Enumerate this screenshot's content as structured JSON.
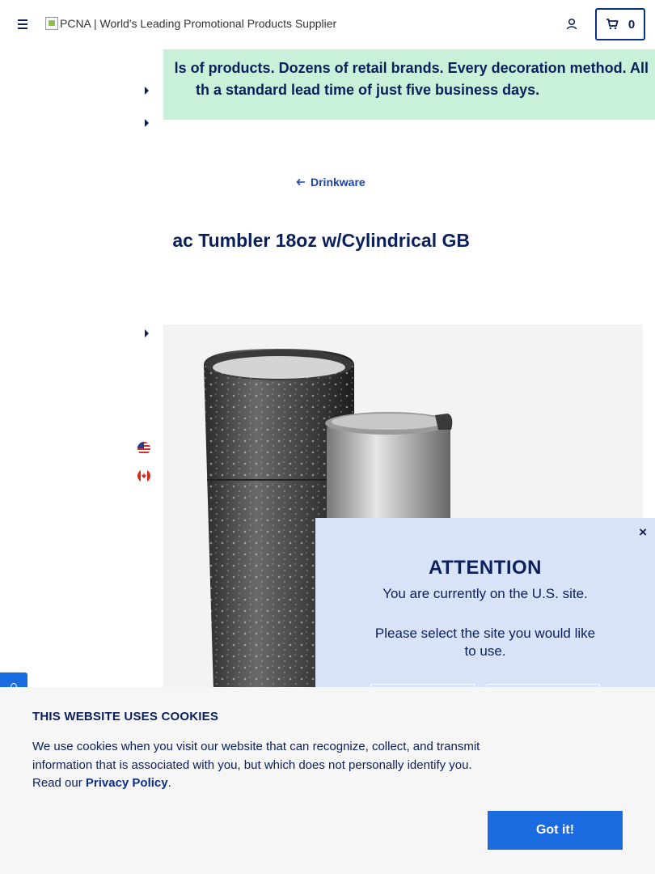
{
  "header": {
    "logo_alt": "PCNA | World's Leading Promotional Products Supplier",
    "menu_icon": "hamburger-menu-icon",
    "account_icon": "user-icon",
    "cart_icon": "cart-icon",
    "cart_count": "0"
  },
  "banner": {
    "line1": "ls of products. Dozens of retail brands. Every decoration method. All",
    "line2": "th a standard lead time of just five business days."
  },
  "breadcrumb": {
    "back_label": "Drinkware",
    "back_icon": "arrow-left-icon"
  },
  "product": {
    "title": "ac Tumbler 18oz w/Cylindrical GB"
  },
  "locale_flags": [
    {
      "icon": "us-flag-icon"
    },
    {
      "icon": "canada-flag-icon"
    }
  ],
  "attention_modal": {
    "close": "×",
    "title": "ATTENTION",
    "current_site": "You are currently on the U.S. site.",
    "prompt": "Please select the site you would like to use."
  },
  "cookie_banner": {
    "title": "THIS WEBSITE USES COOKIES",
    "body": "We use cookies when you visit our website that can recognize, collect, and transmit information that is associated with you, but which does not personally identify you. Read our ",
    "policy_link": "Privacy Policy",
    "period": ".",
    "accept_label": "Got it!"
  },
  "colors": {
    "navy": "#0b1f5c",
    "banner_green": "#c9f0d8",
    "accent_blue": "#1a6be0",
    "modal_bg": "#d9e3f7"
  }
}
